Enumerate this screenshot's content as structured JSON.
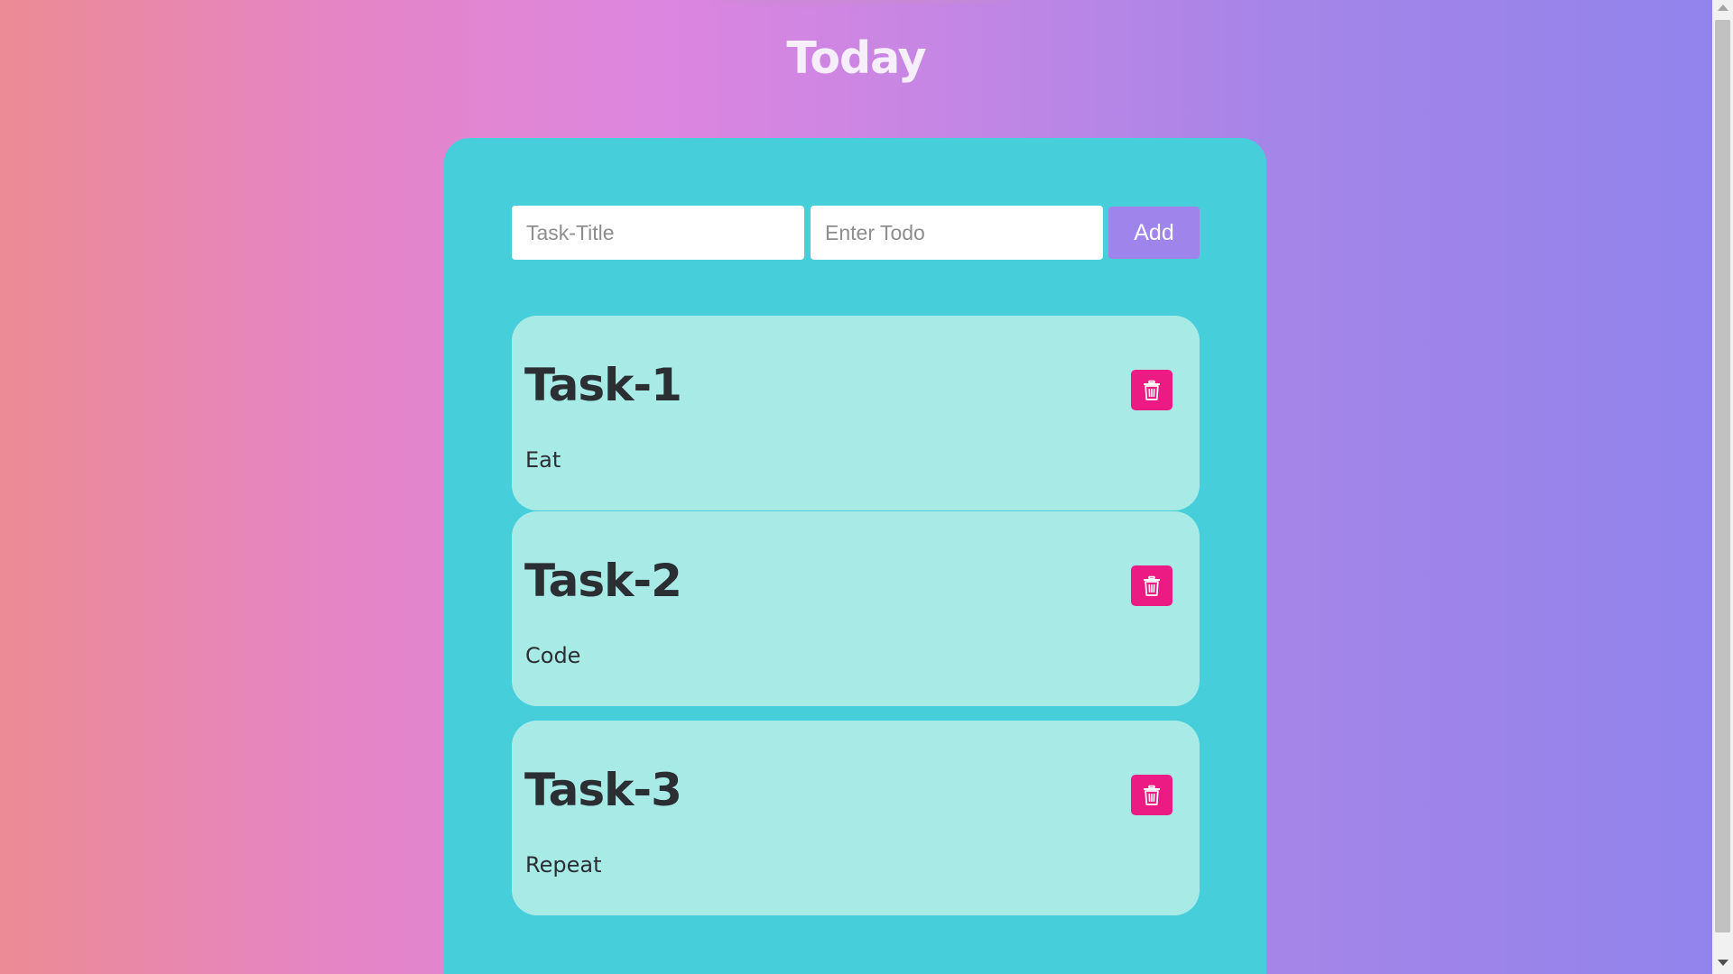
{
  "header": {
    "title": "Today"
  },
  "form": {
    "title_placeholder": "Task-Title",
    "todo_placeholder": "Enter Todo",
    "title_value": "",
    "todo_value": "",
    "add_label": "Add"
  },
  "tasks": [
    {
      "title": "Task-1",
      "description": "Eat",
      "delete_icon": "trash-icon"
    },
    {
      "title": "Task-2",
      "description": "Code",
      "delete_icon": "trash-icon"
    },
    {
      "title": "Task-3",
      "description": "Repeat",
      "delete_icon": "trash-icon"
    }
  ],
  "colors": {
    "container": "#46cedb",
    "card": "#a8ebe6",
    "add_button": "#9f84ec",
    "delete_button": "#ec1a83",
    "gradient_start": "#ec8b94",
    "gradient_end": "#9184ec"
  }
}
